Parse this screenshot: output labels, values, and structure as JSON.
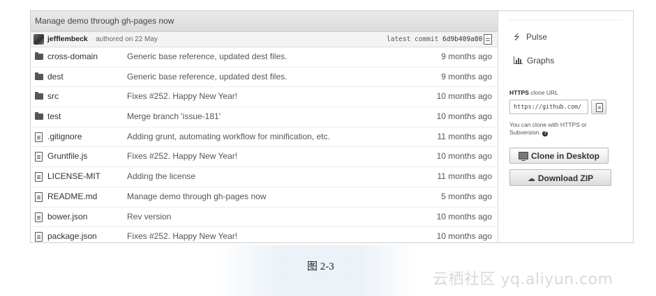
{
  "commit": {
    "message": "Manage demo through gh-pages now",
    "author": "jefflembeck",
    "authored_text": "authored on 22 May",
    "latest_label": "latest commit",
    "sha": "6d9b409a80"
  },
  "files": [
    {
      "type": "folder",
      "name": "cross-domain",
      "message": "Generic base reference, updated dest files.",
      "age": "9 months ago"
    },
    {
      "type": "folder",
      "name": "dest",
      "message": "Generic base reference, updated dest files.",
      "age": "9 months ago"
    },
    {
      "type": "folder",
      "name": "src",
      "message": "Fixes #252. Happy New Year!",
      "age": "10 months ago"
    },
    {
      "type": "folder",
      "name": "test",
      "message": "Merge branch 'issue-181'",
      "age": "10 months ago"
    },
    {
      "type": "file",
      "name": ".gitignore",
      "message": "Adding grunt, automating workflow for minification, etc.",
      "age": "11 months ago"
    },
    {
      "type": "file",
      "name": "Gruntfile.js",
      "message": "Fixes #252. Happy New Year!",
      "age": "10 months ago"
    },
    {
      "type": "file",
      "name": "LICENSE-MIT",
      "message": "Adding the license",
      "age": "11 months ago"
    },
    {
      "type": "file",
      "name": "README.md",
      "message": "Manage demo through gh-pages now",
      "age": "5 months ago"
    },
    {
      "type": "file",
      "name": "bower.json",
      "message": "Rev version",
      "age": "10 months ago"
    },
    {
      "type": "file",
      "name": "package.json",
      "message": "Fixes #252. Happy New Year!",
      "age": "10 months ago"
    }
  ],
  "sidebar": {
    "pulse_label": "Pulse",
    "graphs_label": "Graphs",
    "clone": {
      "protocol": "HTTPS",
      "label_rest": " clone URL",
      "url": "https://github.com/",
      "help_text": "You can clone with HTTPS or Subversion."
    },
    "clone_desktop_label": "Clone in Desktop",
    "download_zip_label": "Download ZIP"
  },
  "caption": "图 2-3",
  "watermark": "云栖社区 yq.aliyun.com",
  "icons": {
    "folder": "folder-icon",
    "file": "file-icon",
    "pulse": "pulse-icon",
    "graphs": "graphs-icon",
    "clipboard": "clipboard-icon",
    "desktop": "desktop-icon",
    "download": "cloud-download-icon",
    "help": "question-circle-icon"
  }
}
